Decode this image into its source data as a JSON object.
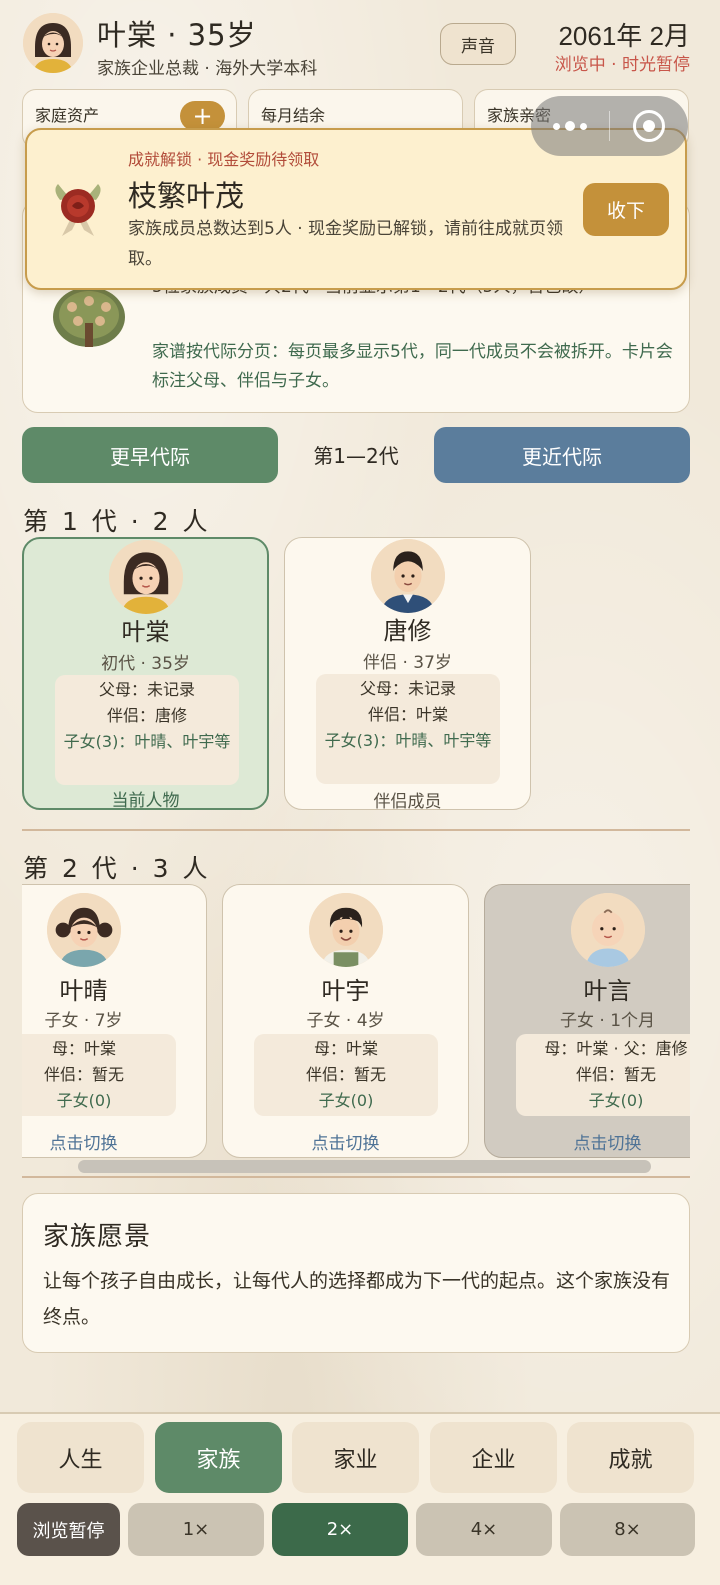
{
  "header": {
    "name": "叶棠 · 35岁",
    "subtitle": "家族企业总裁 · 海外大学本科",
    "sound_label": "声音",
    "date": "2061年 2月",
    "status": "浏览中 · 时光暂停"
  },
  "stats": [
    {
      "label": "家庭资产"
    },
    {
      "label": "每月结余"
    },
    {
      "label": "家族亲密"
    }
  ],
  "plus_label": "+",
  "toast": {
    "kicker": "成就解锁 · 现金奖励待领取",
    "title": "枝繁叶茂",
    "body": "家族成员总数达到5人 · 现金奖励已解锁，请前往成就页领取。",
    "button": "收下"
  },
  "family_info": {
    "line1": "5位家族成员 · 共2代 · 当前显示第1—2代（5人，含已故）",
    "line2": "家谱按代际分页：每页最多显示5代，同一代成员不会被拆开。卡片会标注父母、伴侣与子女。"
  },
  "pager": {
    "earlier": "更早代际",
    "current": "第1—2代",
    "later": "更近代际"
  },
  "generations": [
    {
      "title": "第 1 代 · 2 人",
      "members": [
        {
          "name": "叶棠",
          "role": "初代 · 35岁",
          "parents": "父母：未记录",
          "partner": "伴侣：唐修",
          "children": "子女(3)：叶晴、叶宇等",
          "footer": "当前人物"
        },
        {
          "name": "唐修",
          "role": "伴侣 · 37岁",
          "parents": "父母：未记录",
          "partner": "伴侣：叶棠",
          "children": "子女(3)：叶晴、叶宇等",
          "footer": "伴侣成员"
        }
      ]
    },
    {
      "title": "第 2 代 · 3 人",
      "members": [
        {
          "name": "叶晴",
          "role": "子女 · 7岁",
          "parents": "母：叶棠",
          "partner": "伴侣：暂无",
          "children": "子女(0)",
          "footer": "点击切换"
        },
        {
          "name": "叶宇",
          "role": "子女 · 4岁",
          "parents": "母：叶棠",
          "partner": "伴侣：暂无",
          "children": "子女(0)",
          "footer": "点击切换"
        },
        {
          "name": "叶言",
          "role": "子女 · 1个月",
          "parents": "母：叶棠 · 父：唐修",
          "partner": "伴侣：暂无",
          "children": "子女(0)",
          "footer": "点击切换"
        }
      ]
    }
  ],
  "vision": {
    "title": "家族愿景",
    "body": "让每个孩子自由成长，让每代人的选择都成为下一代的起点。这个家族没有终点。"
  },
  "nav": [
    "人生",
    "家族",
    "家业",
    "企业",
    "成就"
  ],
  "speed": [
    "浏览暂停",
    "1×",
    "2×",
    "4×",
    "8×"
  ],
  "colors": {
    "primary_green": "#5e8a68",
    "accent_gold": "#c4913a",
    "accent_blue": "#5b7d9c",
    "alert_red": "#c8564a"
  }
}
